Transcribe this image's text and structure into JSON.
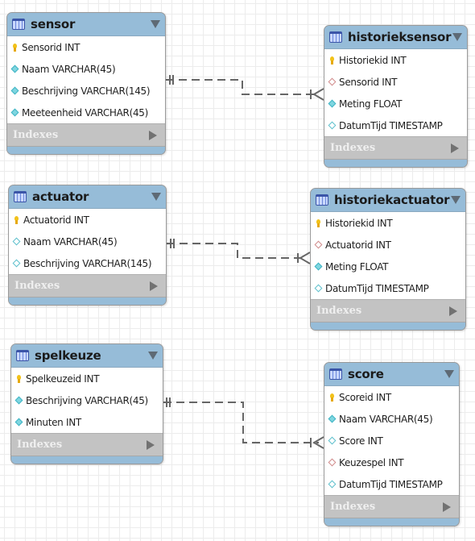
{
  "diagram": {
    "tables": [
      {
        "id": "sensor",
        "name": "sensor",
        "columns": [
          {
            "label": "Sensorid INT",
            "kind": "primary-key"
          },
          {
            "label": "Naam VARCHAR(45)",
            "kind": "not-null"
          },
          {
            "label": "Beschrijving VARCHAR(145)",
            "kind": "not-null"
          },
          {
            "label": "Meeteenheid VARCHAR(45)",
            "kind": "not-null"
          }
        ],
        "indexes_label": "Indexes"
      },
      {
        "id": "historieksensor",
        "name": "historieksensor",
        "columns": [
          {
            "label": "Historiekid INT",
            "kind": "primary-key"
          },
          {
            "label": "Sensorid INT",
            "kind": "foreign-key"
          },
          {
            "label": "Meting FLOAT",
            "kind": "not-null"
          },
          {
            "label": "DatumTijd TIMESTAMP",
            "kind": "nullable"
          }
        ],
        "indexes_label": "Indexes"
      },
      {
        "id": "actuator",
        "name": "actuator",
        "columns": [
          {
            "label": "Actuatorid INT",
            "kind": "primary-key"
          },
          {
            "label": "Naam VARCHAR(45)",
            "kind": "nullable"
          },
          {
            "label": "Beschrijving VARCHAR(145)",
            "kind": "nullable"
          }
        ],
        "indexes_label": "Indexes"
      },
      {
        "id": "historiekactuator",
        "name": "historiekactuator",
        "columns": [
          {
            "label": "Historiekid INT",
            "kind": "primary-key"
          },
          {
            "label": "Actuatorid INT",
            "kind": "foreign-key"
          },
          {
            "label": "Meting FLOAT",
            "kind": "not-null"
          },
          {
            "label": "DatumTijd TIMESTAMP",
            "kind": "nullable"
          }
        ],
        "indexes_label": "Indexes"
      },
      {
        "id": "spelkeuze",
        "name": "spelkeuze",
        "columns": [
          {
            "label": "Spelkeuzeid INT",
            "kind": "primary-key"
          },
          {
            "label": "Beschrijving VARCHAR(45)",
            "kind": "not-null"
          },
          {
            "label": "Minuten INT",
            "kind": "not-null"
          }
        ],
        "indexes_label": "Indexes"
      },
      {
        "id": "score",
        "name": "score",
        "columns": [
          {
            "label": "Scoreid INT",
            "kind": "primary-key"
          },
          {
            "label": "Naam VARCHAR(45)",
            "kind": "not-null"
          },
          {
            "label": "Score INT",
            "kind": "nullable"
          },
          {
            "label": "Keuzespel INT",
            "kind": "foreign-key"
          },
          {
            "label": "DatumTijd TIMESTAMP",
            "kind": "nullable"
          }
        ],
        "indexes_label": "Indexes"
      }
    ],
    "relationships": [
      {
        "from": "sensor",
        "to": "historieksensor",
        "type": "one-to-many",
        "style": "dashed"
      },
      {
        "from": "actuator",
        "to": "historiekactuator",
        "type": "one-to-many",
        "style": "dashed"
      },
      {
        "from": "spelkeuze",
        "to": "score",
        "type": "one-to-many",
        "style": "dashed"
      }
    ]
  }
}
